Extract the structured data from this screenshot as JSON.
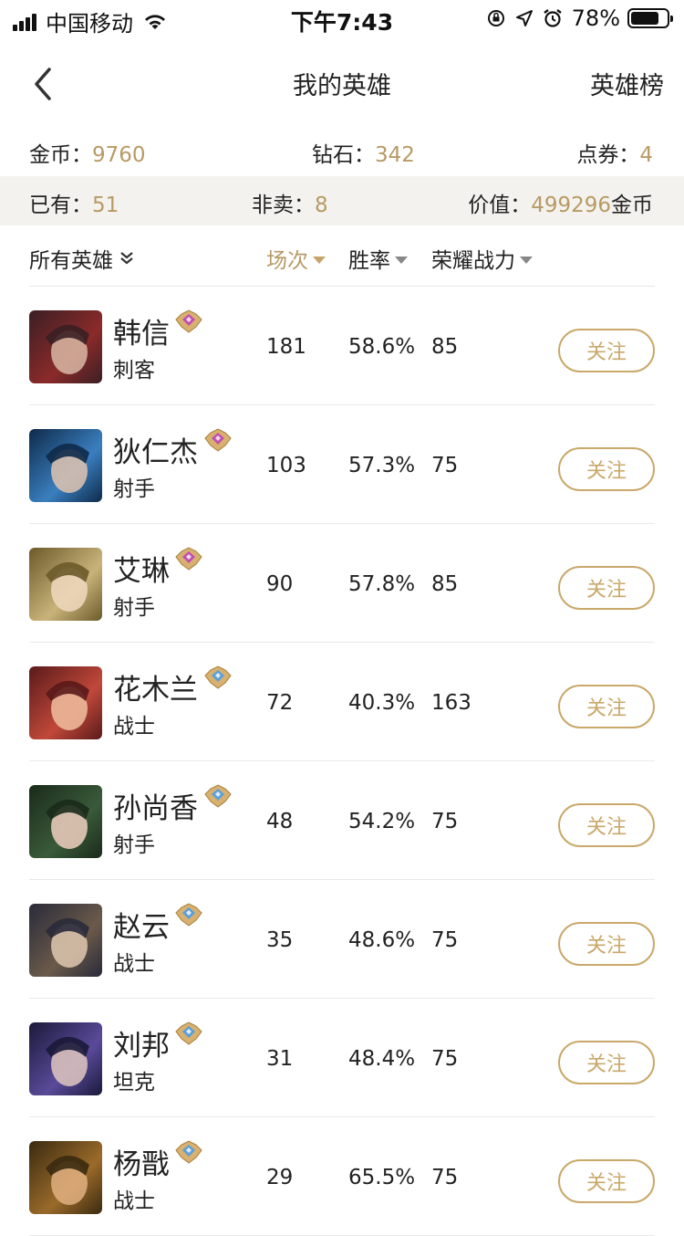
{
  "status_bar": {
    "carrier": "中国移动",
    "time": "下午7:43",
    "battery": "78%",
    "battery_level": 0.78
  },
  "nav": {
    "title": "我的英雄",
    "right_label": "英雄榜"
  },
  "summary": {
    "coins_label": "金币：",
    "coins_value": "9760",
    "diamonds_label": "钻石：",
    "diamonds_value": "342",
    "vouchers_label": "点券：",
    "vouchers_value": "4",
    "owned_label": "已有：",
    "owned_value": "51",
    "not_sold_label": "非卖：",
    "not_sold_value": "8",
    "worth_label": "价值：",
    "worth_value": "499296",
    "worth_unit": "金币"
  },
  "table_header": {
    "filter": "所有英雄",
    "matches": "场次",
    "win_rate": "胜率",
    "power": "荣耀战力"
  },
  "heroes": [
    {
      "name": "韩信",
      "role": "刺客",
      "matches": "181",
      "win_rate": "58.6%",
      "power": "85",
      "follow": "关注",
      "rank": "purple",
      "avatar_colors": [
        "#3a1f24",
        "#8b2a2a",
        "#d9b9a5"
      ]
    },
    {
      "name": "狄仁杰",
      "role": "射手",
      "matches": "103",
      "win_rate": "57.3%",
      "power": "75",
      "follow": "关注",
      "rank": "purple",
      "avatar_colors": [
        "#0e2a4a",
        "#3a7fbf",
        "#e0c4b0"
      ]
    },
    {
      "name": "艾琳",
      "role": "射手",
      "matches": "90",
      "win_rate": "57.8%",
      "power": "85",
      "follow": "关注",
      "rank": "purple",
      "avatar_colors": [
        "#6b5a2a",
        "#c9b37a",
        "#f0d8c0"
      ]
    },
    {
      "name": "花木兰",
      "role": "战士",
      "matches": "72",
      "win_rate": "40.3%",
      "power": "163",
      "follow": "关注",
      "rank": "blue",
      "avatar_colors": [
        "#5a1a1a",
        "#c0483a",
        "#f0c0a0"
      ]
    },
    {
      "name": "孙尚香",
      "role": "射手",
      "matches": "48",
      "win_rate": "54.2%",
      "power": "75",
      "follow": "关注",
      "rank": "blue",
      "avatar_colors": [
        "#1a2a1a",
        "#3a5a3a",
        "#f0d0c0"
      ]
    },
    {
      "name": "赵云",
      "role": "战士",
      "matches": "35",
      "win_rate": "48.6%",
      "power": "75",
      "follow": "关注",
      "rank": "blue",
      "avatar_colors": [
        "#2a2a3a",
        "#6a5a4a",
        "#e0c8b0"
      ]
    },
    {
      "name": "刘邦",
      "role": "坦克",
      "matches": "31",
      "win_rate": "48.4%",
      "power": "75",
      "follow": "关注",
      "rank": "blue",
      "avatar_colors": [
        "#1a1a3a",
        "#5a4a9a",
        "#e0c8c0"
      ]
    },
    {
      "name": "杨戬",
      "role": "战士",
      "matches": "29",
      "win_rate": "65.5%",
      "power": "75",
      "follow": "关注",
      "rank": "blue",
      "avatar_colors": [
        "#3a2a10",
        "#9a6a2a",
        "#e0b080"
      ]
    }
  ],
  "colors": {
    "accent_gold": "#b89a64",
    "button_gold": "#c9a86a",
    "band_bg": "#f4f2ee"
  }
}
